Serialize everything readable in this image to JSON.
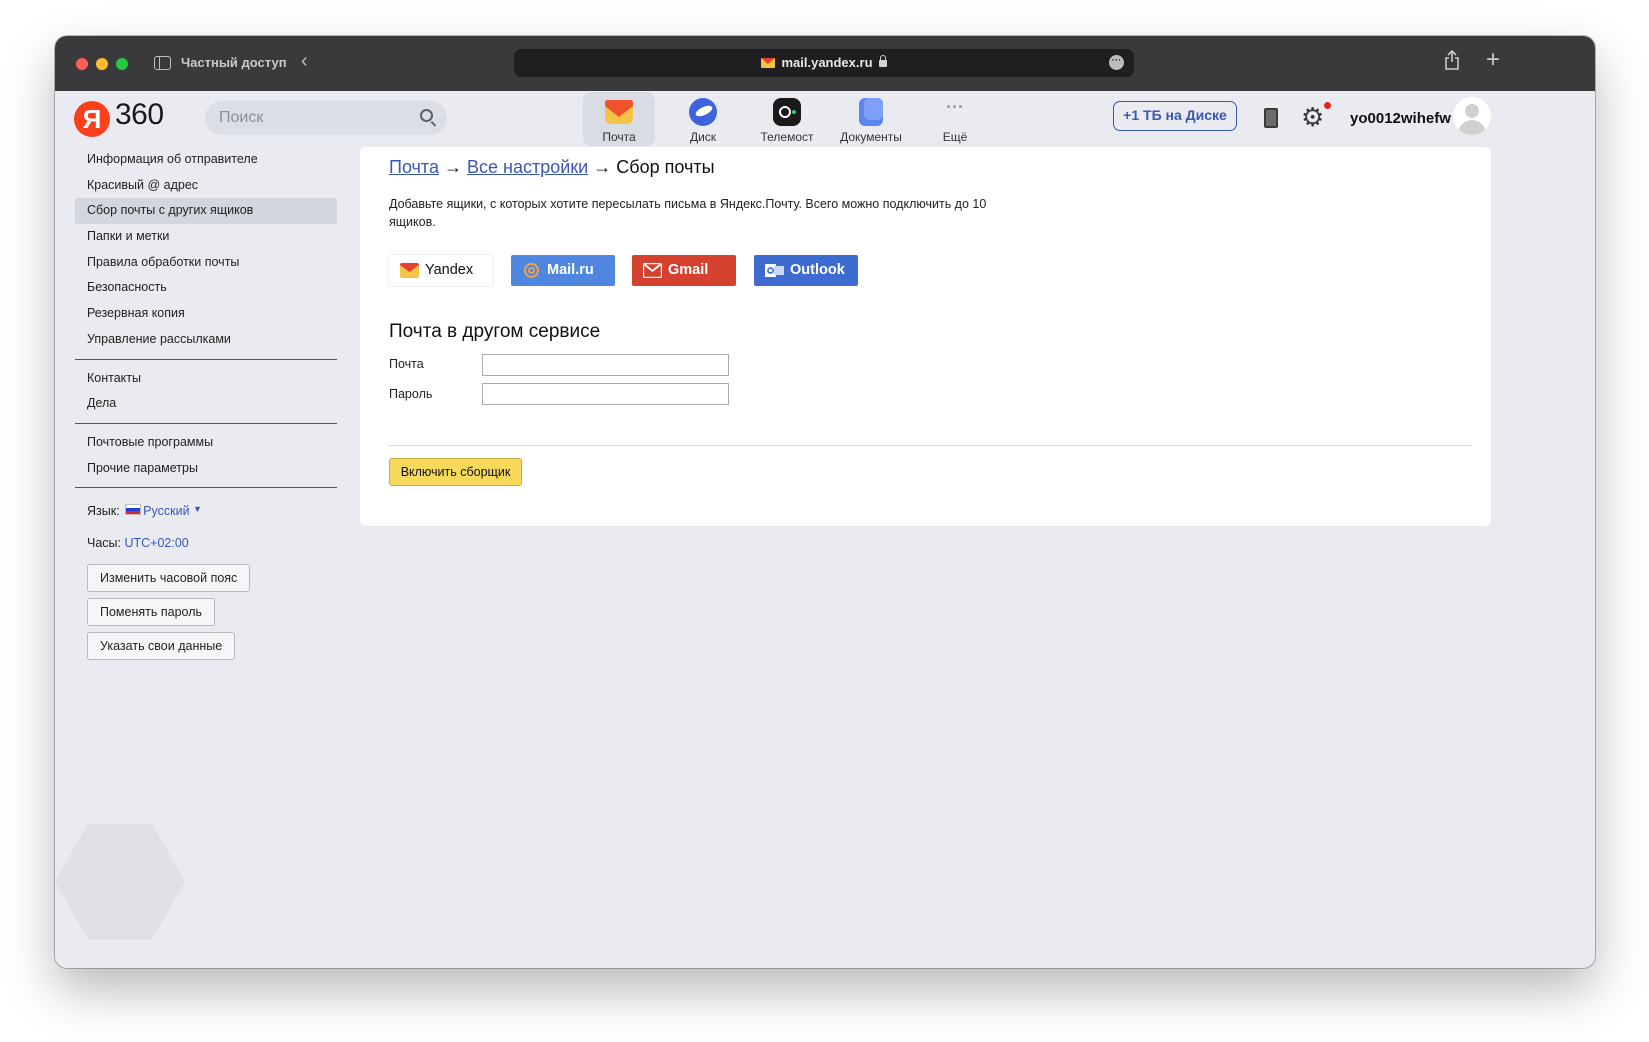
{
  "browser": {
    "private_label": "Частный доступ",
    "url": "mail.yandex.ru"
  },
  "header": {
    "logo_letter": "Я",
    "logo_text": "360",
    "search_placeholder": "Поиск",
    "services": [
      {
        "label": "Почта",
        "icon": "mail-icon",
        "color": "#f6c445"
      },
      {
        "label": "Диск",
        "icon": "disk-icon",
        "color": "#3d63df"
      },
      {
        "label": "Телемост",
        "icon": "telemost-icon",
        "color": "#1a1a1a"
      },
      {
        "label": "Документы",
        "icon": "documents-icon",
        "color": "#5b86f2"
      },
      {
        "label": "Ещё",
        "icon": "more-icon",
        "color": "#9a9ca3"
      }
    ],
    "disk_offer": "+1 ТБ на Диске",
    "username": "yo0012wihefw"
  },
  "sidebar": {
    "group1": [
      "Информация об отправителе",
      "Красивый @ адрес",
      "Сбор почты с других ящиков",
      "Папки и метки",
      "Правила обработки почты",
      "Безопасность",
      "Резервная копия",
      "Управление рассылками"
    ],
    "active_item": "Сбор почты с других ящиков",
    "group2": [
      "Контакты",
      "Дела"
    ],
    "group3": [
      "Почтовые программы",
      "Прочие параметры"
    ],
    "language_label": "Язык:",
    "language_value": "Русский",
    "clock_label": "Часы:",
    "clock_value": "UTC+02:00",
    "buttons": [
      "Изменить часовой пояс",
      "Поменять пароль",
      "Указать свои данные"
    ]
  },
  "main": {
    "breadcrumb": {
      "link1": "Почта",
      "sep": "→",
      "link2": "Все настройки",
      "current": "Сбор почты"
    },
    "intro": "Добавьте ящики, с которых хотите пересылать письма в Яндекс.Почту. Всего можно подключить до 10 ящиков.",
    "providers": [
      {
        "label": "Yandex",
        "color": "#ffffff"
      },
      {
        "label": "Mail.ru",
        "color": "#4f86e0"
      },
      {
        "label": "Gmail",
        "color": "#d4412f"
      },
      {
        "label": "Outlook",
        "color": "#3d6bd0"
      }
    ],
    "section_title": "Почта в другом сервисе",
    "fields": [
      {
        "label": "Почта",
        "value": ""
      },
      {
        "label": "Пароль",
        "value": ""
      }
    ],
    "submit_label": "Включить сборщик"
  },
  "colors": {
    "accent_link": "#3a57b4",
    "submit_yellow": "#f6d95a",
    "logo_red": "#fc3f1d"
  }
}
